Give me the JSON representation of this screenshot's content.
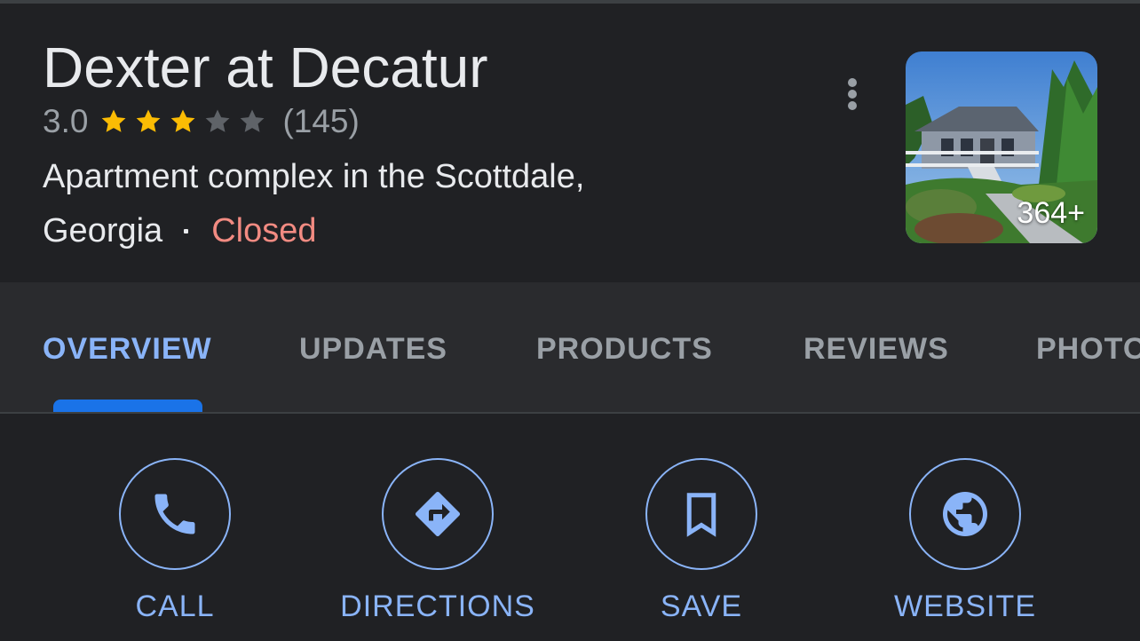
{
  "place": {
    "title": "Dexter at Decatur",
    "rating_value": "3.0",
    "rating": 3.0,
    "rating_max": 5,
    "review_count": "(145)",
    "category_line": "Apartment complex in the Scottdale,",
    "location_line": "Georgia",
    "status": "Closed",
    "photo_count": "364+"
  },
  "tabs": [
    {
      "label": "OVERVIEW",
      "active": true
    },
    {
      "label": "UPDATES",
      "active": false
    },
    {
      "label": "PRODUCTS",
      "active": false
    },
    {
      "label": "REVIEWS",
      "active": false
    },
    {
      "label": "PHOTOS",
      "active": false
    }
  ],
  "actions": [
    {
      "label": "CALL",
      "icon": "phone-icon"
    },
    {
      "label": "DIRECTIONS",
      "icon": "directions-icon"
    },
    {
      "label": "SAVE",
      "icon": "bookmark-icon"
    },
    {
      "label": "WEBSITE",
      "icon": "globe-icon"
    }
  ],
  "colors": {
    "background": "#202124",
    "tab_bar": "#2a2b2e",
    "accent": "#8ab4f8",
    "indicator": "#1a73e8",
    "star_filled": "#fbbc04",
    "star_empty": "#5f6368",
    "closed": "#f28b82",
    "text_primary": "#e8eaed",
    "text_secondary": "#9aa0a6"
  }
}
